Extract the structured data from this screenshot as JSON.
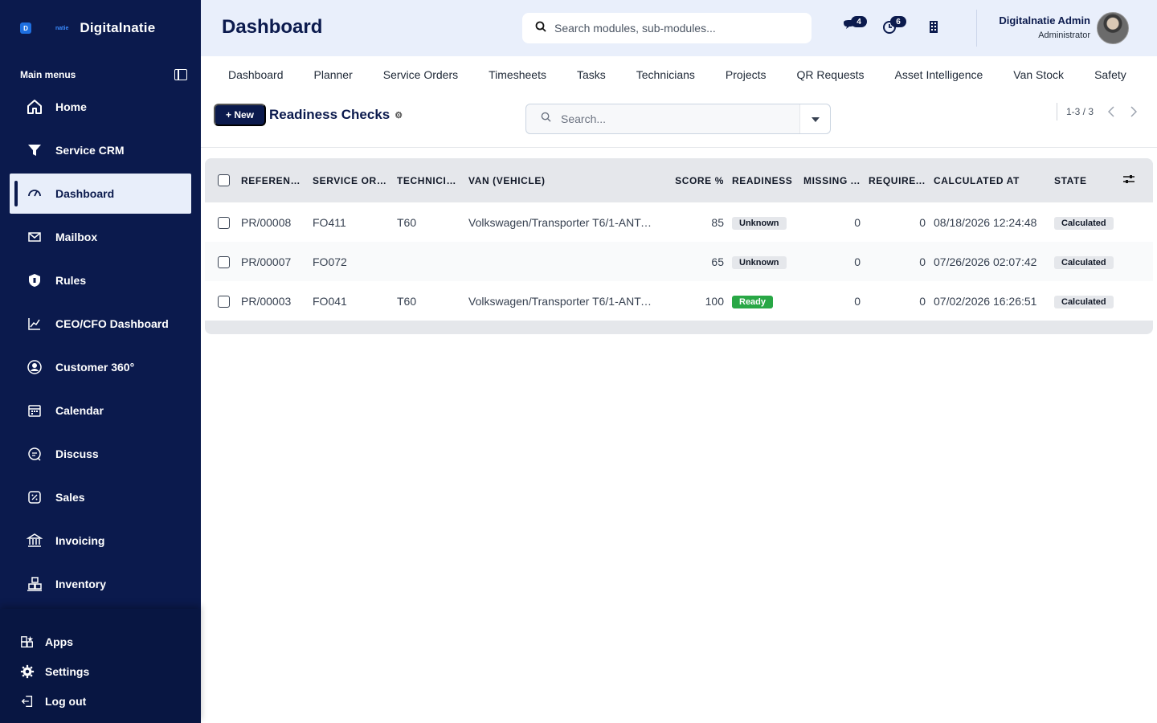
{
  "brand": {
    "mark": "D",
    "small": "natie",
    "name": "Digitalnatie"
  },
  "sidebar": {
    "heading": "Main menus",
    "items": [
      {
        "label": "Home",
        "icon": "home-icon"
      },
      {
        "label": "Service CRM",
        "icon": "filter-icon"
      },
      {
        "label": "Dashboard",
        "icon": "gauge-icon",
        "active": true
      },
      {
        "label": "Mailbox",
        "icon": "mail-icon"
      },
      {
        "label": "Rules",
        "icon": "shield-icon"
      },
      {
        "label": "CEO/CFO Dashboard",
        "icon": "chart-line-icon"
      },
      {
        "label": "Customer 360°",
        "icon": "user-circle-icon"
      },
      {
        "label": "Calendar",
        "icon": "calendar-icon"
      },
      {
        "label": "Discuss",
        "icon": "chat-icon"
      },
      {
        "label": "Sales",
        "icon": "percent-icon"
      },
      {
        "label": "Invoicing",
        "icon": "bank-icon"
      },
      {
        "label": "Inventory",
        "icon": "boxes-icon"
      }
    ],
    "bottom": [
      {
        "label": "Apps",
        "icon": "apps-icon"
      },
      {
        "label": "Settings",
        "icon": "gear-icon"
      },
      {
        "label": "Log out",
        "icon": "logout-icon"
      }
    ]
  },
  "header": {
    "title": "Dashboard",
    "search_placeholder": "Search modules, sub-modules...",
    "messages_count": "4",
    "activities_count": "6",
    "user_name": "Digitalnatie Admin",
    "user_role": "Administrator"
  },
  "topnav": [
    "Dashboard",
    "Planner",
    "Service Orders",
    "Timesheets",
    "Tasks",
    "Technicians",
    "Projects",
    "QR Requests",
    "Asset Intelligence",
    "Van Stock",
    "Safety"
  ],
  "control": {
    "new_label": "+ New",
    "list_title": "Readiness Checks",
    "search_placeholder": "Search...",
    "pager": "1-3 / 3"
  },
  "table": {
    "columns": [
      "REFERENCE",
      "SERVICE ORD...",
      "TECHNICIA...",
      "VAN (VEHICLE)",
      "SCORE %",
      "READINESS",
      "MISSING ...",
      "REQUIRE...",
      "CALCULATED AT",
      "STATE"
    ],
    "rows": [
      {
        "reference": "PR/00008",
        "service_order": "FO411",
        "technician": "T60",
        "van": "Volkswagen/Transporter T6/1-ANT-0...",
        "score": "85",
        "readiness": "Unknown",
        "missing": "0",
        "required": "0",
        "calculated_at": "08/18/2026 12:24:48",
        "state": "Calculated"
      },
      {
        "reference": "PR/00007",
        "service_order": "FO072",
        "technician": "",
        "van": "",
        "score": "65",
        "readiness": "Unknown",
        "missing": "0",
        "required": "0",
        "calculated_at": "07/26/2026 02:07:42",
        "state": "Calculated"
      },
      {
        "reference": "PR/00003",
        "service_order": "FO041",
        "technician": "T60",
        "van": "Volkswagen/Transporter T6/1-ANT-0...",
        "score": "100",
        "readiness": "Ready",
        "missing": "0",
        "required": "0",
        "calculated_at": "07/02/2026 16:26:51",
        "state": "Calculated"
      }
    ]
  },
  "colors": {
    "navy": "#0b1a4d",
    "ready_green": "#28a745",
    "header_bg": "#e9effb"
  }
}
